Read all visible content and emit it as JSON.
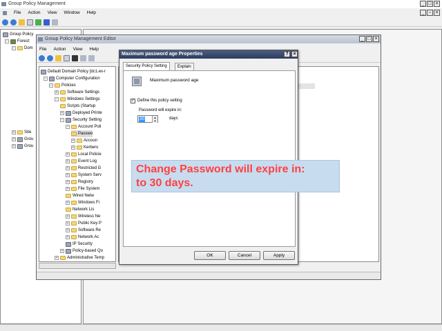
{
  "gpm": {
    "title": "Group Policy Management",
    "menu": [
      "File",
      "Action",
      "View",
      "Window",
      "Help"
    ],
    "tree": [
      "Group Policy",
      "Forest:",
      "Dom"
    ]
  },
  "editor": {
    "title": "Group Policy Management Editor",
    "menu": [
      "File",
      "Action",
      "View",
      "Help"
    ],
    "tree": [
      {
        "label": "Default Domain Policy [dc1.ex-r",
        "icon": "policy"
      },
      {
        "label": "Computer Configuration",
        "icon": "computer"
      },
      {
        "label": "Policies",
        "icon": "folder"
      },
      {
        "label": "Software Settings",
        "icon": "folder"
      },
      {
        "label": "Windows Settings",
        "icon": "folder"
      },
      {
        "label": "Scripts (Startup",
        "icon": "doc"
      },
      {
        "label": "Deployed Printe",
        "icon": "printer"
      },
      {
        "label": "Security Setting",
        "icon": "gear"
      },
      {
        "label": "Account Poli",
        "icon": "folder"
      },
      {
        "label": "Passwo",
        "icon": "folder"
      },
      {
        "label": "Accoun",
        "icon": "folder"
      },
      {
        "label": "Kerbero",
        "icon": "folder"
      },
      {
        "label": "Local Policie",
        "icon": "folder"
      },
      {
        "label": "Event Log",
        "icon": "folder"
      },
      {
        "label": "Restricted G",
        "icon": "folder"
      },
      {
        "label": "System Serv",
        "icon": "folder"
      },
      {
        "label": "Registry",
        "icon": "folder"
      },
      {
        "label": "File System",
        "icon": "folder"
      },
      {
        "label": "Wired Netw",
        "icon": "folder"
      },
      {
        "label": "Windows Fi",
        "icon": "folder"
      },
      {
        "label": "Network Lis",
        "icon": "folder"
      },
      {
        "label": "Wireless Ne",
        "icon": "folder"
      },
      {
        "label": "Public Key P",
        "icon": "folder"
      },
      {
        "label": "Software Re",
        "icon": "folder"
      },
      {
        "label": "Network Ac",
        "icon": "folder"
      },
      {
        "label": "IP Security",
        "icon": "shield"
      },
      {
        "label": "Policy-based Qo",
        "icon": "chart"
      },
      {
        "label": "Administrative Temp",
        "icon": "folder"
      }
    ]
  },
  "gpm_tree_more": [
    "Site",
    "Grou",
    "Grou"
  ],
  "dialog": {
    "title": "Maximum password age Properties",
    "help_btn": "?",
    "close_btn": "×",
    "tabs": [
      "Security Policy Setting",
      "Explain"
    ],
    "policy_name": "Maximum password age",
    "checkbox_label": "Define this policy setting",
    "expire_label": "Password will expire in:",
    "expire_value": "30",
    "unit": "days",
    "ok": "OK",
    "cancel": "Cancel",
    "apply": "Apply"
  },
  "callout": {
    "line1": "Change Password will expire in:",
    "line2": "to 30 days."
  },
  "colors": {
    "callout_text": "#ff4040",
    "callout_bg": "#c8dcf0",
    "active_title": "#2c3c5f"
  }
}
